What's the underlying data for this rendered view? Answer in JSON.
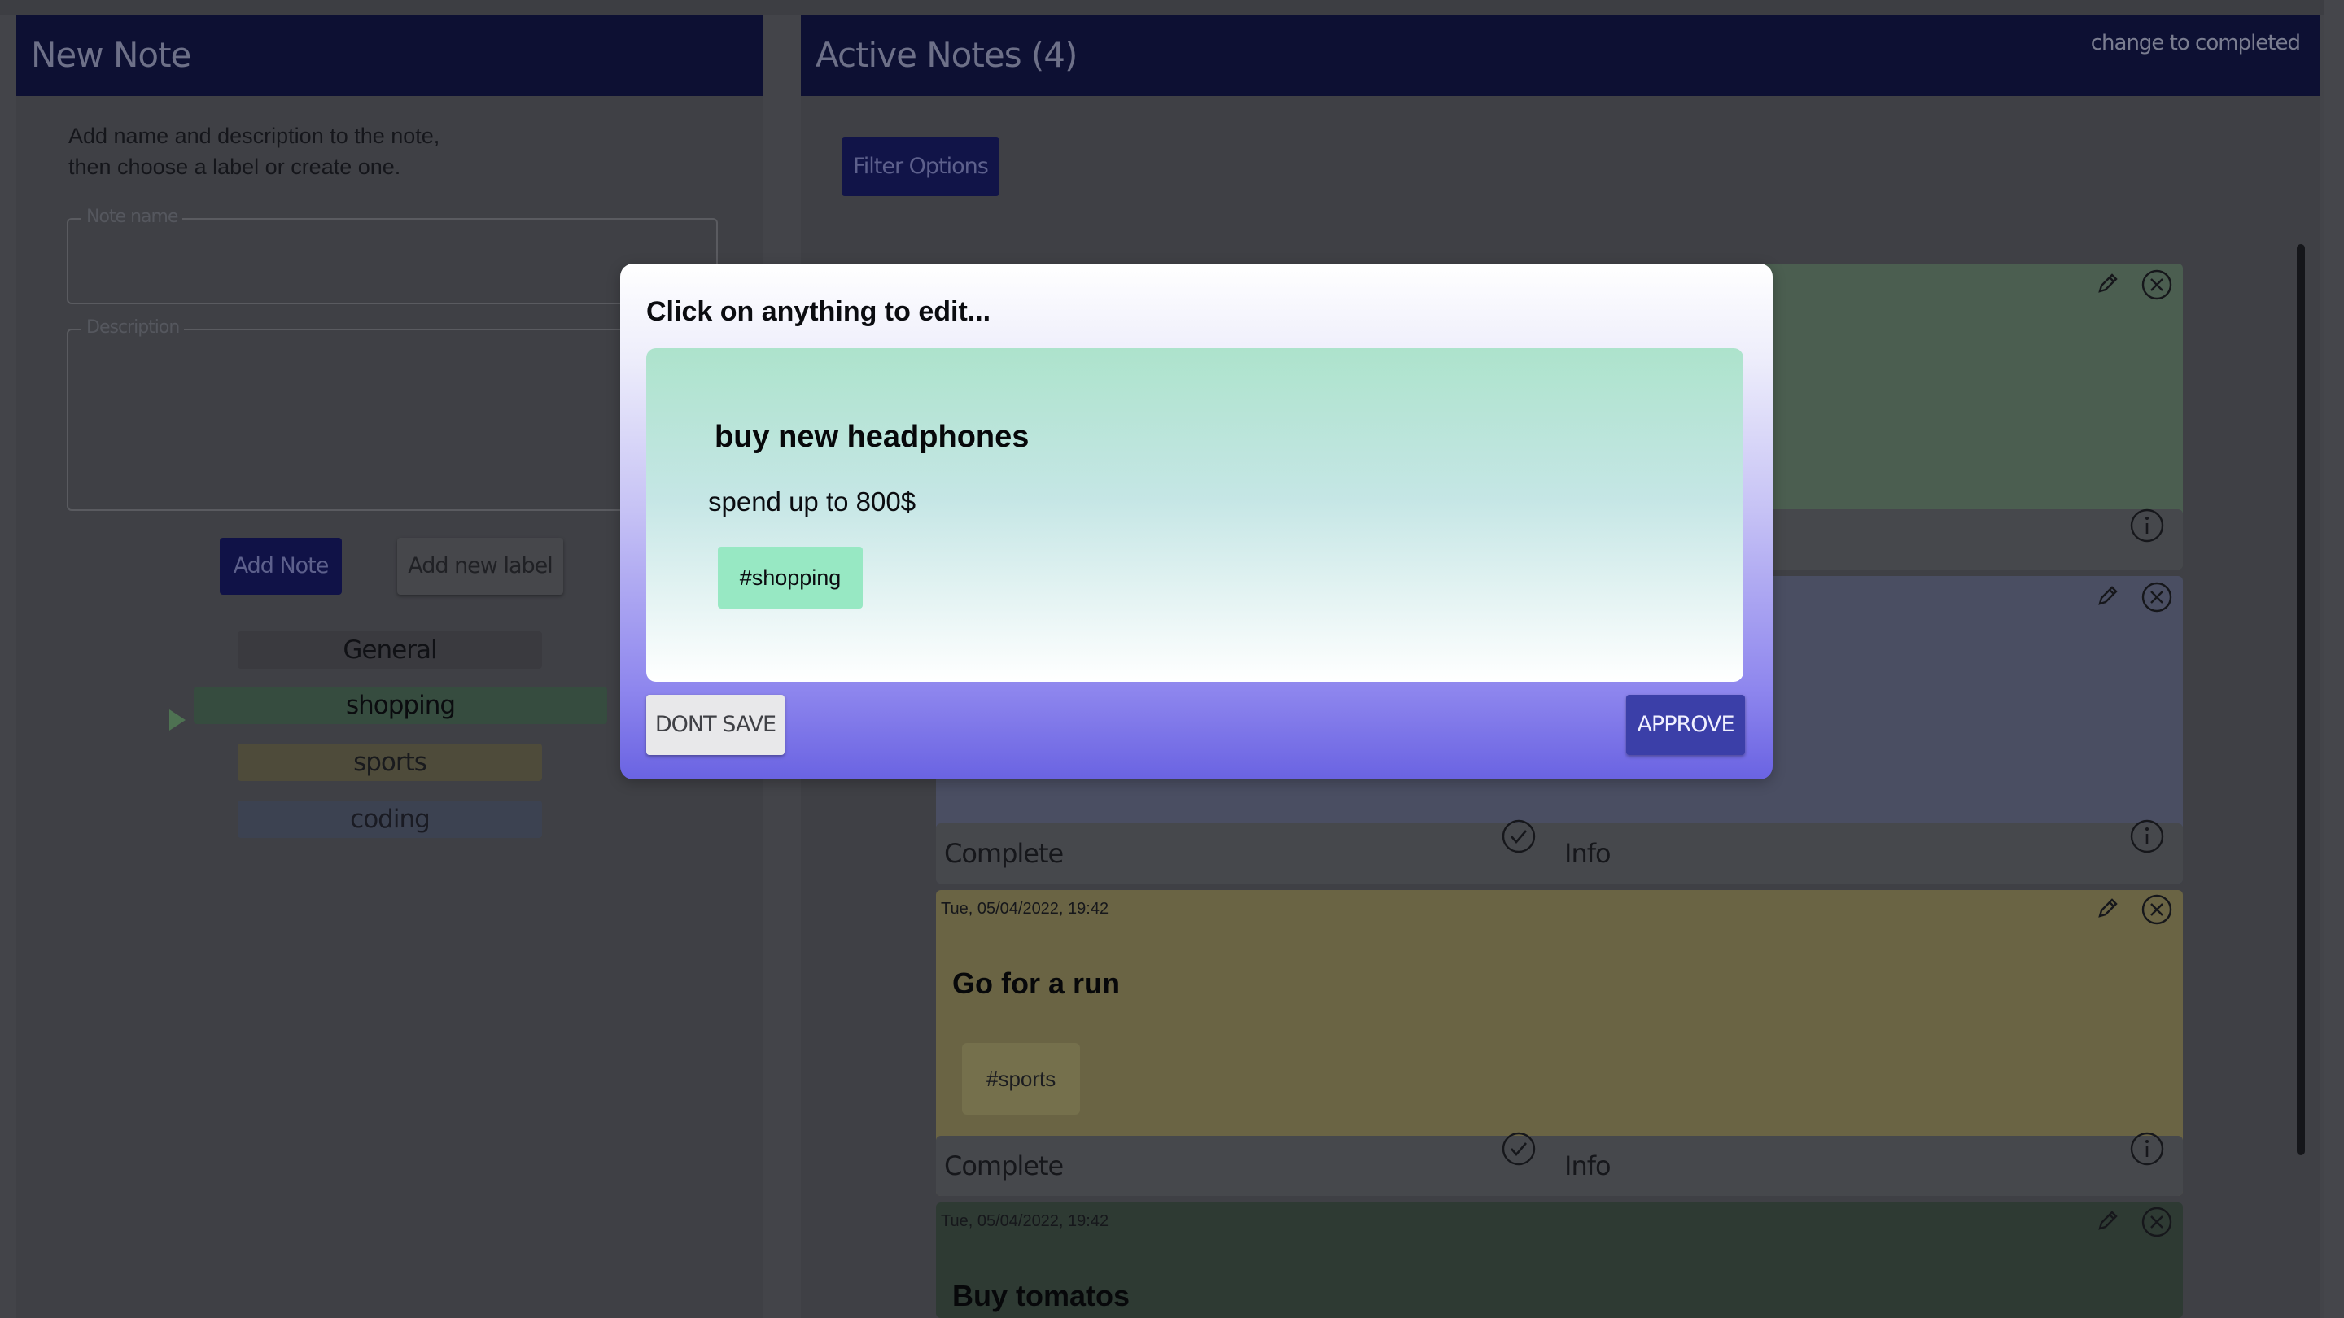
{
  "colors": {
    "header_bg": "#0d1033",
    "page_bg": "#434449",
    "shopping_card": "#4b5e50",
    "coding_card": "#4a4e62",
    "sports_card": "#6a6444",
    "approve": "#3b3fa8",
    "tag_green": "#97e8c3"
  },
  "new_note": {
    "header": "New Note",
    "intro_line1": "Add name and description to the note,",
    "intro_line2": "then choose a label or create one.",
    "note_name_legend": "Note name",
    "description_legend": "Description",
    "add_note_button": "Add Note",
    "add_label_button": "Add new label",
    "labels": [
      "General",
      "shopping",
      "sports",
      "coding"
    ],
    "selected_label": "shopping"
  },
  "active_notes": {
    "header": "Active Notes (4)",
    "change_link": "change to completed",
    "filter_button": "Filter Options",
    "cards": [
      {
        "date": "Tue, 05/04/2022, 19:42",
        "title": "Go for a run",
        "tag": "#sports",
        "complete": "Complete",
        "info": "Info"
      },
      {
        "date": "Tue, 05/04/2022, 19:42",
        "title": "Buy tomatos"
      }
    ],
    "coding_card_footer": {
      "complete": "Complete",
      "info": "Info"
    }
  },
  "modal": {
    "title": "Click on anything to edit...",
    "note_title": "buy new headphones",
    "note_description": "spend up to 800$",
    "note_tag": "#shopping",
    "dont_save_button": "DONT SAVE",
    "approve_button": "APPROVE"
  }
}
